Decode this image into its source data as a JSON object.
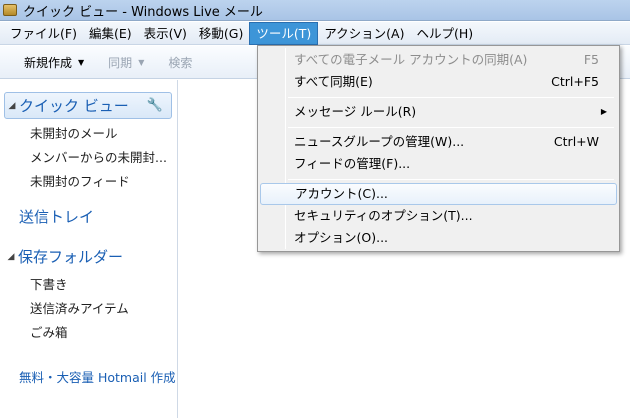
{
  "window": {
    "title": "クイック ビュー - Windows Live メール"
  },
  "menubar": {
    "items": [
      {
        "label": "ファイル(F)"
      },
      {
        "label": "編集(E)"
      },
      {
        "label": "表示(V)"
      },
      {
        "label": "移動(G)"
      },
      {
        "label": "ツール(T)"
      },
      {
        "label": "アクション(A)"
      },
      {
        "label": "ヘルプ(H)"
      }
    ]
  },
  "toolbar": {
    "new_label": "新規作成",
    "sync_label": "同期",
    "search_label": "検索"
  },
  "sidebar": {
    "quick_view": "クイック ビュー",
    "quick_items": [
      {
        "label": "未開封のメール"
      },
      {
        "label": "メンバーからの未開封..."
      },
      {
        "label": "未開封のフィード"
      }
    ],
    "outbox": "送信トレイ",
    "storage_folder": "保存フォルダー",
    "folders": [
      {
        "label": "下書き"
      },
      {
        "label": "送信済みアイテム"
      },
      {
        "label": "ごみ箱"
      }
    ],
    "hotmail_link": "無料・大容量 Hotmail 作成"
  },
  "tools_menu": {
    "items": [
      {
        "label": "すべての電子メール アカウントの同期(A)",
        "shortcut": "F5"
      },
      {
        "label": "すべて同期(E)",
        "shortcut": "Ctrl+F5"
      },
      {
        "label": "メッセージ ルール(R)"
      },
      {
        "label": "ニュースグループの管理(W)...",
        "shortcut": "Ctrl+W"
      },
      {
        "label": "フィードの管理(F)..."
      },
      {
        "label": "アカウント(C)..."
      },
      {
        "label": "セキュリティのオプション(T)..."
      },
      {
        "label": "オプション(O)..."
      }
    ]
  }
}
